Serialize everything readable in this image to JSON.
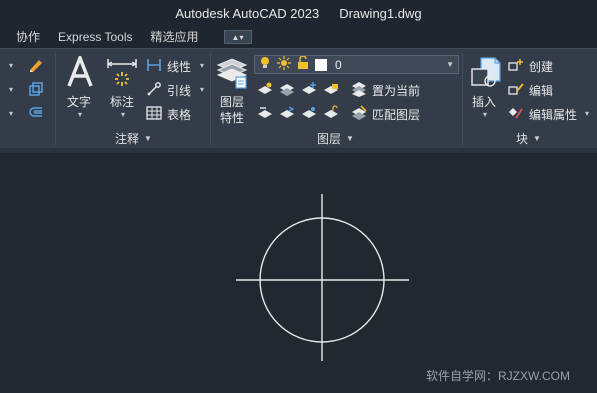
{
  "window": {
    "app_title": "Autodesk AutoCAD 2023",
    "document_title": "Drawing1.dwg"
  },
  "tabs": [
    {
      "label": "协作"
    },
    {
      "label": "Express Tools"
    },
    {
      "label": "精选应用"
    }
  ],
  "ribbon": {
    "annotation_panel": {
      "title": "注释",
      "text_label": "文字",
      "dimension_label": "标注",
      "linear_label": "线性",
      "leader_label": "引线",
      "table_label": "表格"
    },
    "layers_panel": {
      "title": "图层",
      "layer_properties_label_1": "图层",
      "layer_properties_label_2": "特性",
      "current_layer": "0",
      "set_current_label": "置为当前",
      "match_layer_label": "匹配图层"
    },
    "block_panel": {
      "title": "块",
      "insert_label": "插入",
      "create_label": "创建",
      "edit_label": "编辑",
      "edit_attributes_label": "编辑属性"
    }
  },
  "watermark": "软件自学网：RJZXW.COM",
  "colors": {
    "canvas_background": "#212830",
    "ribbon_background": "#333c48",
    "drawing_stroke": "#e8e8e8",
    "accent_yellow": "#f2c12e",
    "accent_blue": "#5aa0e0"
  }
}
